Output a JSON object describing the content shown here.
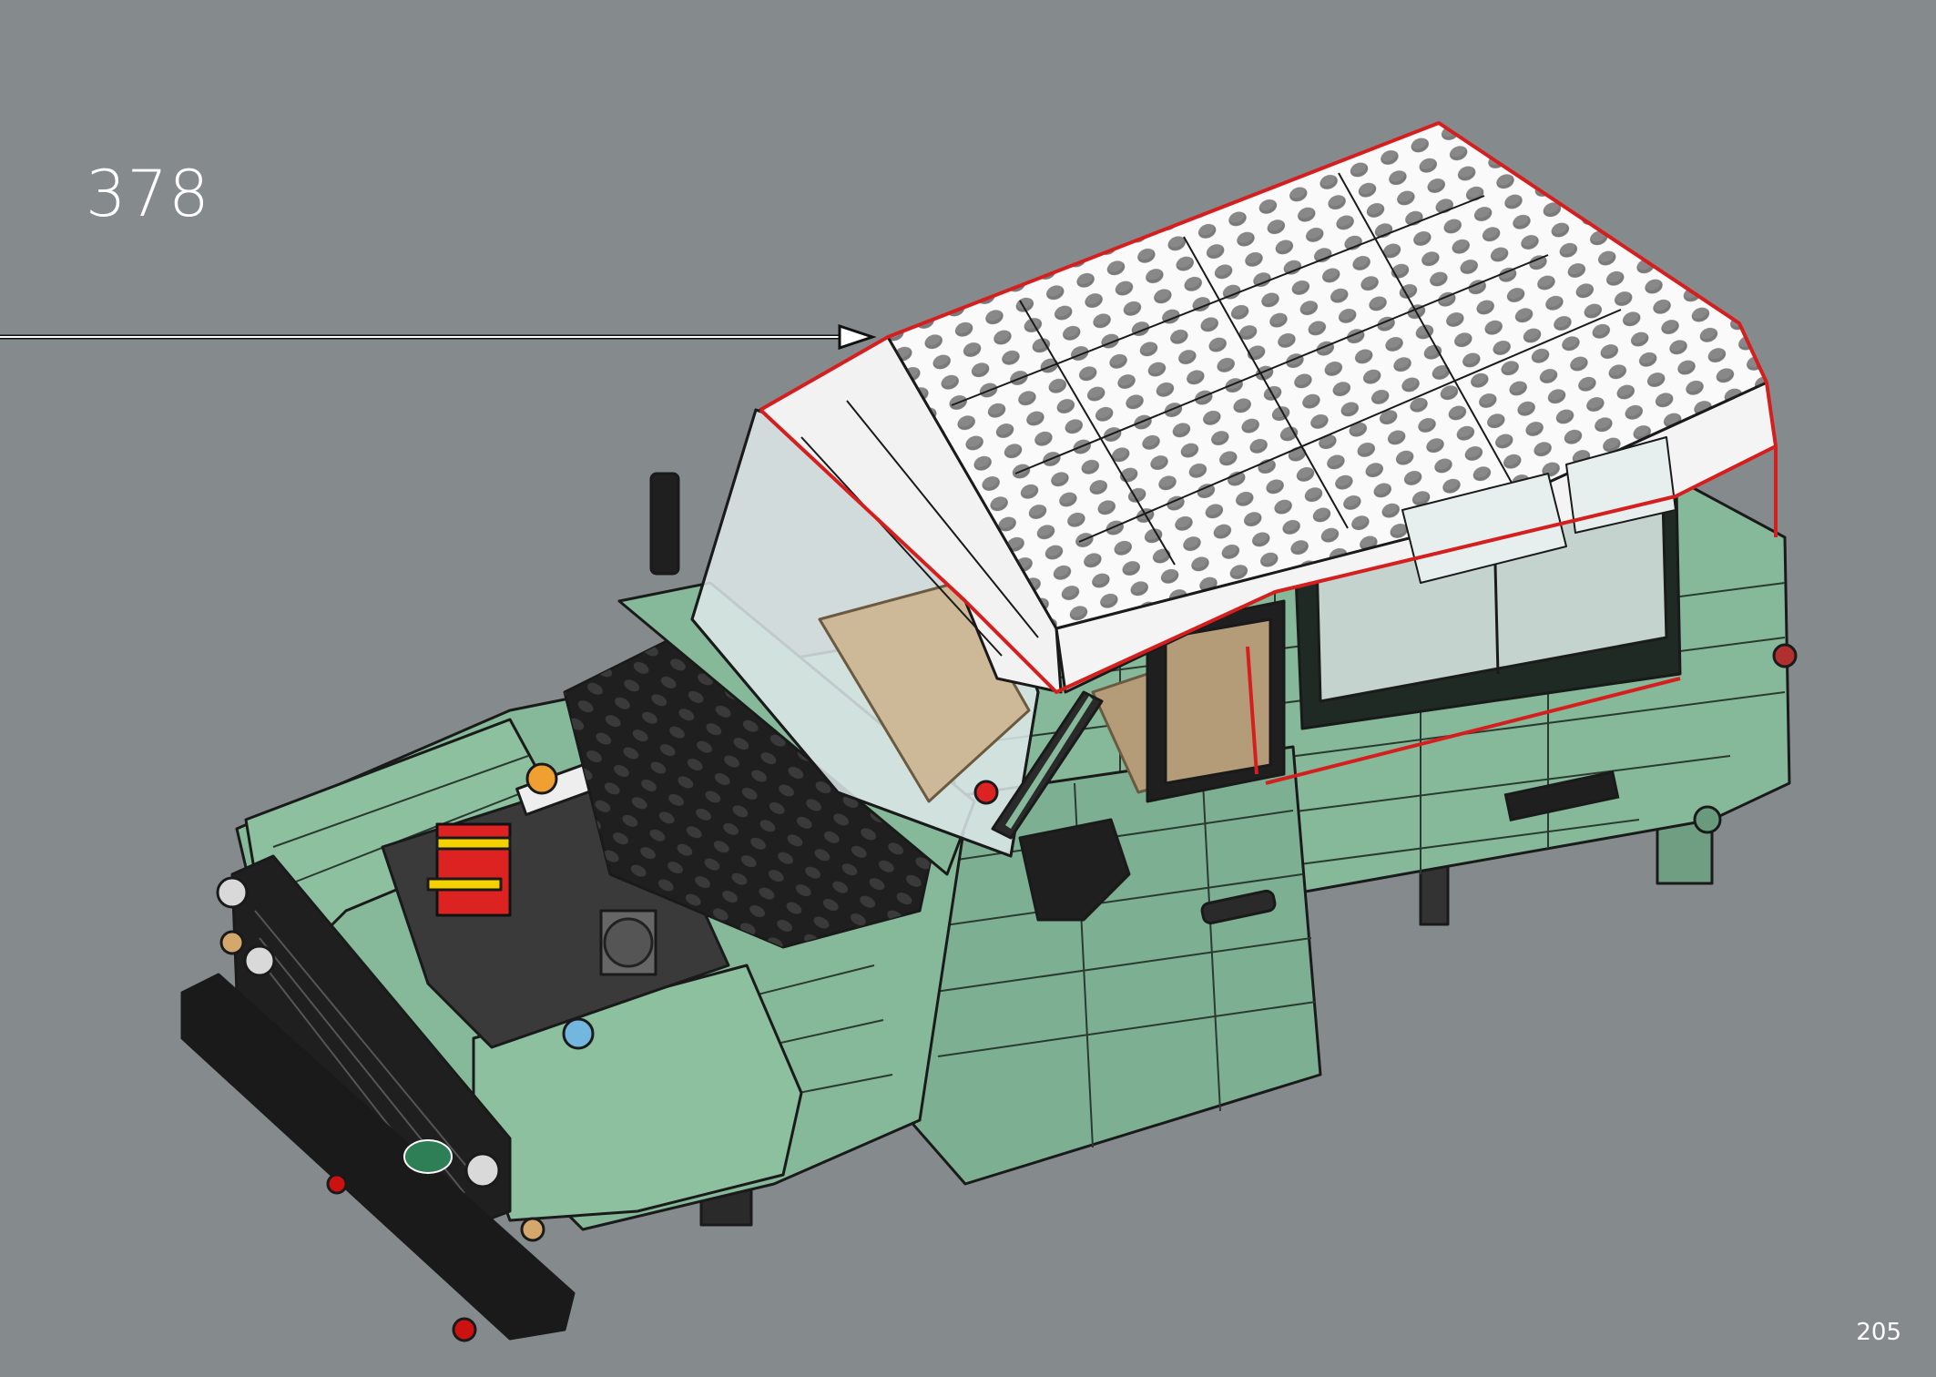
{
  "step": {
    "number": "378"
  },
  "page": {
    "number": "205"
  },
  "colors": {
    "background": "#858b8d",
    "body_green": "#86b999",
    "roof_white": "#f4f4f4",
    "highlight_outline": "#d51f1f",
    "outline": "#111111"
  },
  "icons": {
    "arrow": "arrow-right-icon",
    "model": "lego-land-rover-model"
  }
}
